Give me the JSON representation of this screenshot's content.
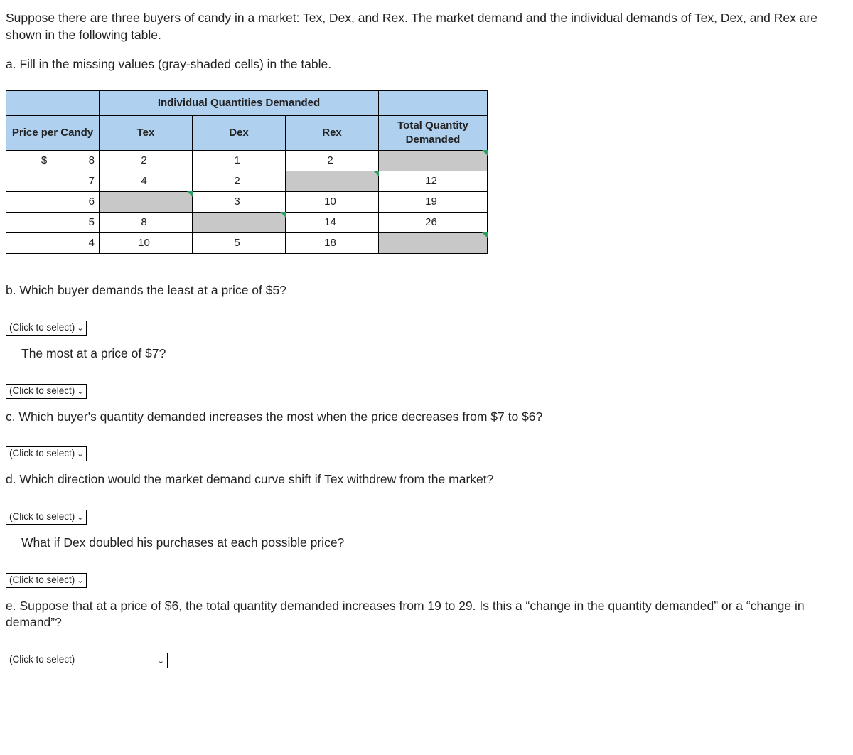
{
  "intro": "Suppose there are three buyers of candy in a market: Tex, Dex, and Rex. The market demand and the individual demands of Tex, Dex, and Rex are shown in the following table.",
  "part_a": "a. Fill in the missing values (gray-shaded cells) in the table.",
  "table": {
    "group_header": "Individual Quantities Demanded",
    "headers": {
      "price": "Price per Candy",
      "tex": "Tex",
      "dex": "Dex",
      "rex": "Rex",
      "total": "Total Quantity Demanded"
    },
    "currency": "$",
    "rows": [
      {
        "price": "8",
        "tex": "2",
        "dex": "1",
        "rex": "2",
        "total": "",
        "total_gray": true
      },
      {
        "price": "7",
        "tex": "4",
        "dex": "2",
        "rex": "",
        "rex_gray": true,
        "total": "12"
      },
      {
        "price": "6",
        "tex": "",
        "tex_gray": true,
        "dex": "3",
        "rex": "10",
        "total": "19"
      },
      {
        "price": "5",
        "tex": "8",
        "dex": "",
        "dex_gray": true,
        "rex": "14",
        "total": "26"
      },
      {
        "price": "4",
        "tex": "10",
        "dex": "5",
        "rex": "18",
        "total": "",
        "total_gray": true
      }
    ]
  },
  "part_b": "b. Which buyer demands the least at a price of $5?",
  "part_b2": "The most at a price of $7?",
  "part_c": "c. Which buyer's quantity demanded increases the most when the price decreases from $7 to $6?",
  "part_d": "d. Which direction would the market demand curve shift if Tex withdrew from the market?",
  "part_d2": "What if Dex doubled his purchases at each possible price?",
  "part_e": "e. Suppose that at a price of $6, the total quantity demanded increases from 19 to 29. Is this a “change in the quantity demanded” or a “change in demand”?",
  "select_label": "(Click to select)",
  "caret": "⌄"
}
